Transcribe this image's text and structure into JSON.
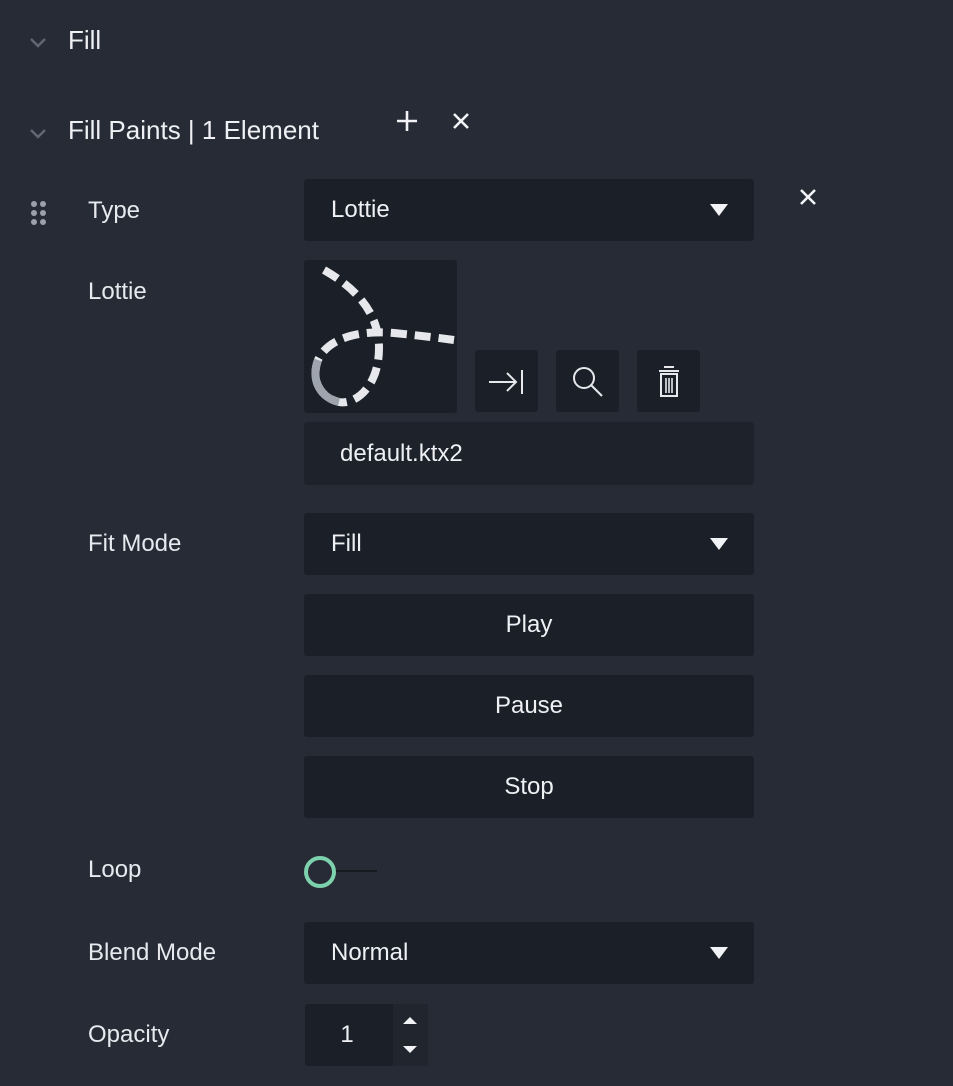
{
  "sections": {
    "fill": {
      "title": "Fill"
    },
    "fill_paints": {
      "title": "Fill Paints | 1 Element"
    }
  },
  "fields": {
    "type": {
      "label": "Type",
      "value": "Lottie"
    },
    "lottie": {
      "label": "Lottie",
      "file_name": "default.ktx2"
    },
    "fit_mode": {
      "label": "Fit Mode",
      "value": "Fill"
    },
    "loop": {
      "label": "Loop",
      "enabled": false
    },
    "blend_mode": {
      "label": "Blend Mode",
      "value": "Normal"
    },
    "opacity": {
      "label": "Opacity",
      "value": "1"
    }
  },
  "buttons": {
    "play": "Play",
    "pause": "Pause",
    "stop": "Stop"
  },
  "icons": {
    "collapse": "chevron-down-icon",
    "add": "plus-icon",
    "remove": "close-icon",
    "drag": "drag-handle-icon",
    "select_asset": "arrow-to-end-icon",
    "find_asset": "search-icon",
    "delete_asset": "trash-icon"
  },
  "colors": {
    "panel_bg": "#262b35",
    "control_bg": "#1b1f27",
    "toggle_accent": "#7ed1ad",
    "text": "#e7e9ee"
  }
}
